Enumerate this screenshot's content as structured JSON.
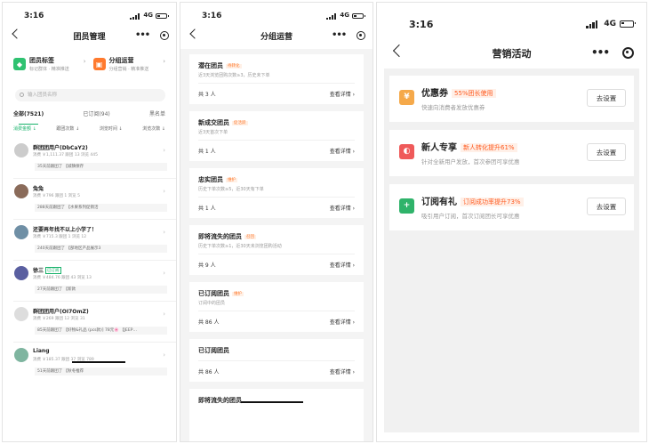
{
  "status": {
    "time": "3:16",
    "network": "4G"
  },
  "screen1": {
    "title": "团员管理",
    "features": [
      {
        "title": "团员标签",
        "subtitle": "标记群体 · 精准推送",
        "color": "#2fc271"
      },
      {
        "title": "分组运营",
        "subtitle": "分组营销 · 精准推送",
        "color": "#ff7a2e"
      }
    ],
    "search_placeholder": "输入团员名称",
    "tabs": [
      "全部(7521)",
      "已订阅(94)",
      "黑名单"
    ],
    "sorts": [
      "消费金额 ↓",
      "跟团次数 ↓",
      "浏览时间 ↓",
      "浏览次数 ↓"
    ],
    "members": [
      {
        "name": "群团团用户(DbCaY2)",
        "tag": "",
        "stats": "消费 ￥1,111.37  跟团 13  浏览 445",
        "label": "35天前跟团了 【城镇保存",
        "avatar": "#cccccc"
      },
      {
        "name": "兔兔",
        "tag": "",
        "stats": "消费 ￥796  跟团 1  浏览 5",
        "label": "288天前跟团了 【水果系列促销活",
        "avatar": "#8a6b5a"
      },
      {
        "name": "还要再年找不以上小学了！",
        "tag": "",
        "stats": "消费 ￥715.3  跟团 1  浏览 12",
        "label": "240天前跟团了 【部地区产品展示3",
        "avatar": "#6f8fa5"
      },
      {
        "name": "徐三",
        "tag": "已订阅",
        "stats": "消费 ￥484.76  跟团 43  浏览 13",
        "label": "27天前跟团了 【新款",
        "avatar": "#5a5fa0"
      },
      {
        "name": "群团团用户(OI7OmZ)",
        "tag": "",
        "stats": "消费 ￥269  跟团 12  浏览 31",
        "label": "85天前跟团了 【好物&礼品 (pcs款)] 78元🌸 【JEEP…",
        "avatar": "#dddddd"
      },
      {
        "name": "Liang",
        "tag": "",
        "stats": "消费 ￥185.37  跟团 37  浏览 789",
        "label": "51天前跟团了 【秋冬推荐",
        "avatar": "#7fb5a0"
      }
    ]
  },
  "screen2": {
    "title": "分组运营",
    "segments": [
      {
        "title": "潜在团员",
        "badge": "待转化",
        "desc": "近3天浏览团购次数≥3，历史未下单",
        "count": "共 3 人",
        "view": "查看详情 ›"
      },
      {
        "title": "新成交团员",
        "badge": "促活跃",
        "desc": "近3天首次下单",
        "count": "共 1 人",
        "view": "查看详情 ›"
      },
      {
        "title": "忠实团员",
        "badge": "维护",
        "desc": "历史下单次数≥5，近30天有下单",
        "count": "共 1 人",
        "view": "查看详情 ›"
      },
      {
        "title": "即将流失的团员",
        "badge": "召回",
        "desc": "历史下单次数≥1，近30天未浏览团购活动",
        "count": "共 9 人",
        "view": "查看详情 ›"
      },
      {
        "title": "已订阅团员",
        "badge": "维护",
        "desc": "订阅中的团员",
        "count": "共 86 人",
        "view": "查看详情 ›"
      },
      {
        "title": "已订阅团员",
        "badge": "",
        "desc": "",
        "count": "共 86 人",
        "view": "查看详情 ›"
      },
      {
        "title": "即将流失的团员",
        "badge": "",
        "desc": "",
        "count": "",
        "view": ""
      }
    ]
  },
  "screen3": {
    "title": "营销活动",
    "activities": [
      {
        "title": "优惠券",
        "highlight": "55%团长使用",
        "desc": "快速向消费者发放优惠券",
        "button": "去设置",
        "icon": "¥",
        "color": "#f5a94a"
      },
      {
        "title": "新人专享",
        "highlight": "新人转化提升61%",
        "desc": "针对全新用户发放，首次参团可享优惠",
        "button": "去设置",
        "icon": "◐",
        "color": "#ef5a5a"
      },
      {
        "title": "订阅有礼",
        "highlight": "订阅成功率提升73%",
        "desc": "吸引用户订阅，首次订阅团长可享优惠",
        "button": "去设置",
        "icon": "+",
        "color": "#2fb36a"
      }
    ]
  }
}
